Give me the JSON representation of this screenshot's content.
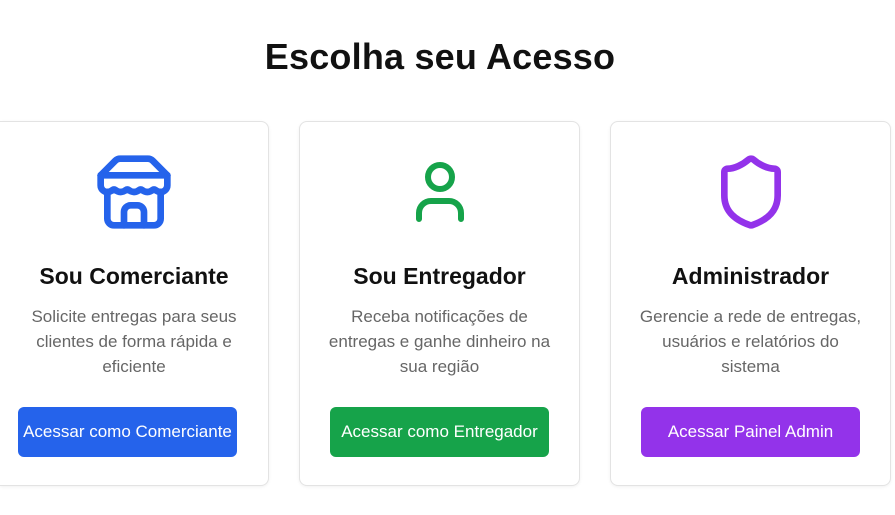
{
  "page": {
    "title": "Escolha seu Acesso"
  },
  "colors": {
    "merchant": "#2563eb",
    "courier": "#16a34a",
    "admin": "#9333ea"
  },
  "cards": [
    {
      "icon": "store-icon",
      "title": "Sou Comerciante",
      "description": "Solicite entregas para seus clientes de forma rápida e eficiente",
      "button_label": "Acessar como Comerciante"
    },
    {
      "icon": "user-icon",
      "title": "Sou Entregador",
      "description": "Receba notificações de entregas e ganhe dinheiro na sua região",
      "button_label": "Acessar como Entregador"
    },
    {
      "icon": "shield-icon",
      "title": "Administrador",
      "description": "Gerencie a rede de entregas, usuários e relatórios do sistema",
      "button_label": "Acessar Painel Admin"
    }
  ]
}
